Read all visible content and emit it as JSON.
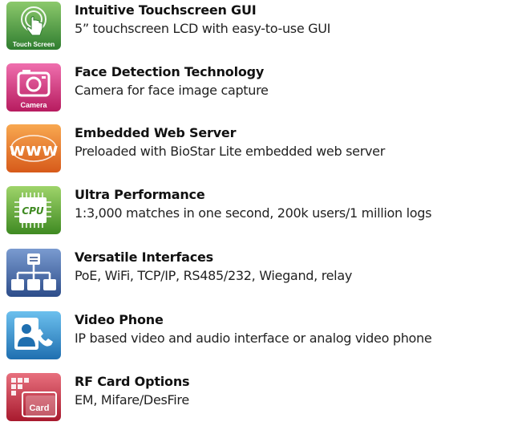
{
  "features": [
    {
      "title": "Intuitive Touchscreen GUI",
      "description": "5” touchscreen LCD with easy-to-use GUI",
      "icon": "touch-screen-icon",
      "icon_label": "Touch Screen",
      "icon_color": "#3c8e3a"
    },
    {
      "title": "Face Detection Technology",
      "description": "Camera for face image capture",
      "icon": "camera-icon",
      "icon_label": "Camera",
      "icon_color": "#d1307a"
    },
    {
      "title": "Embedded Web Server",
      "description": "Preloaded with BioStar Lite embedded web server",
      "icon": "www-icon",
      "icon_label": "www",
      "icon_color": "#e8762c"
    },
    {
      "title": "Ultra Performance",
      "description": "1:3,000 matches in one second, 200k users/1 million logs",
      "icon": "cpu-icon",
      "icon_label": "CPU",
      "icon_color": "#5aa02c"
    },
    {
      "title": "Versatile Interfaces",
      "description": "PoE, WiFi, TCP/IP, RS485/232, Wiegand, relay",
      "icon": "network-icon",
      "icon_label": "",
      "icon_color": "#3d5f9c"
    },
    {
      "title": "Video Phone",
      "description": "IP based video and audio interface or analog video phone",
      "icon": "video-phone-icon",
      "icon_label": "",
      "icon_color": "#2e88c8"
    },
    {
      "title": "RF Card Options",
      "description": "EM, Mifare/DesFire",
      "icon": "card-icon",
      "icon_label": "Card",
      "icon_color": "#c0283c"
    }
  ]
}
